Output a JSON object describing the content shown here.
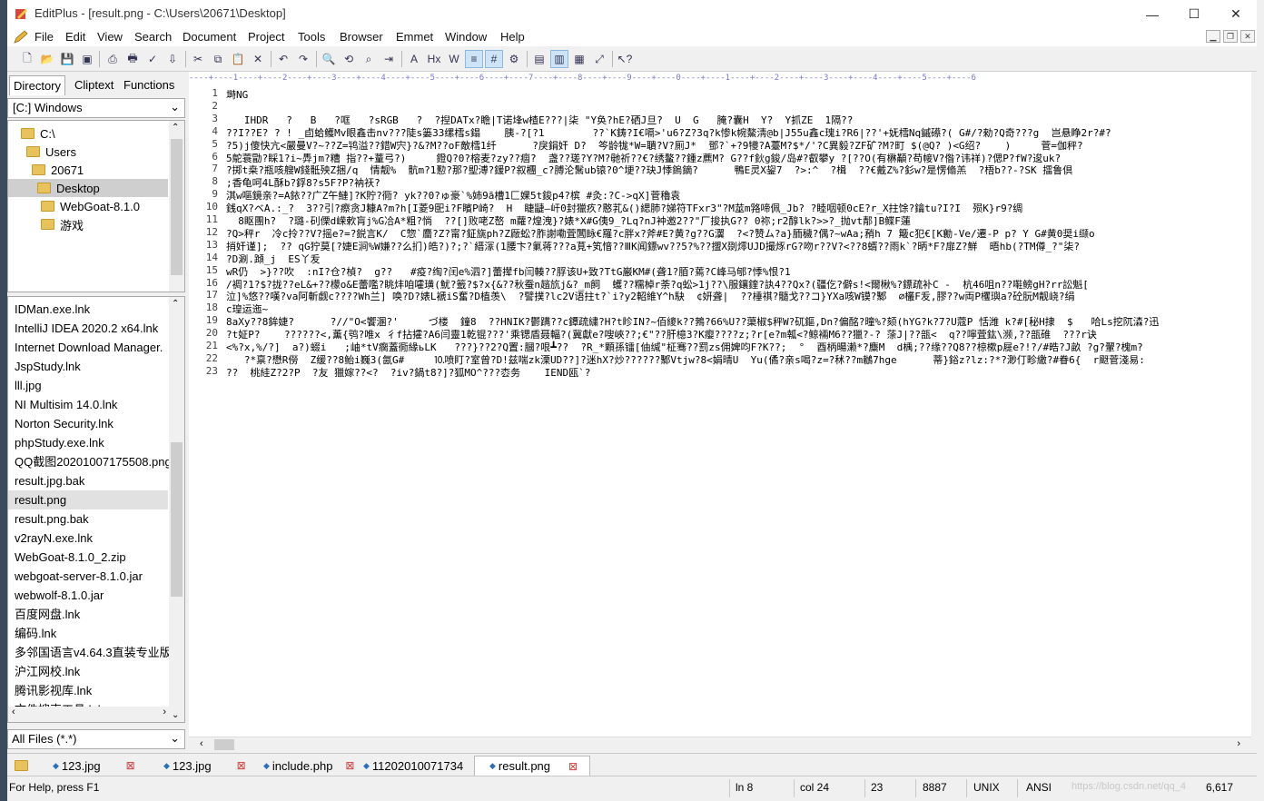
{
  "window": {
    "title": "EditPlus - [result.png - C:\\Users\\20671\\Desktop]",
    "min": "—",
    "max": "☐",
    "close": "✕"
  },
  "menu": [
    "File",
    "Edit",
    "View",
    "Search",
    "Document",
    "Project",
    "Tools",
    "Browser",
    "Emmet",
    "Window",
    "Help"
  ],
  "panel": {
    "tabs": [
      "Directory",
      "Cliptext",
      "Functions"
    ],
    "drive": "[C:] Windows",
    "dirs": [
      "C:\\",
      "Users",
      "20671",
      "Desktop",
      "WebGoat-8.1.0",
      "游戏"
    ],
    "files": [
      "IDMan.exe.lnk",
      "IntelliJ IDEA 2020.2 x64.lnk",
      "Internet Download Manager.",
      "JspStudy.lnk",
      "lll.jpg",
      "NI Multisim 14.0.lnk",
      "Norton Security.lnk",
      "phpStudy.exe.lnk",
      "QQ截图20201007175508.png",
      "result.jpg.bak",
      "result.png",
      "result.png.bak",
      "v2rayN.exe.lnk",
      "WebGoat-8.1.0_2.zip",
      "webgoat-server-8.1.0.jar",
      "webwolf-8.1.0.jar",
      "百度网盘.lnk",
      "编码.lnk",
      "多邻国语言v4.64.3直装专业版.a",
      "沪江网校.lnk",
      "腾讯影视库.lnk",
      "文件搜索工具.lnk"
    ],
    "filter": "All Files (*.*)"
  },
  "editor": {
    "ruler": "----+----1----+----2----+----3----+----4----+----5----+----6----+----7----+----8----+----9----+----0----+----1----+----2----+----3----+----4----+----5----+----6",
    "lines": [
      "塒NG",
      "",
      "   IHDR   ?   B   ?哐   ?sRGB   ?  ?揑DATx?瞻|T诺埄w楂E???|柒 \"Y奂?hE?硒J旦?  U  G   腌?囊H  Y?  Y抓ZE  1隔??",
      "??I??E? ? ! _卣蛤鳠Mv眼鑫击nv???陡s篓33缧樰s鎉    胰-?[?1        ??`K鋳?I€嗝>'u6?Z?3q?k惨k帵鰲淸@b|J55u鑫c瑰i?R6|??'+妩樰Nq鏚礤?( G#/?勑?Q奇???g  岂悬睁2r?#?",
      "?5)j傻快亢<嚴曼V?~??Z=鸨溢??錯W宍}?&?M??oF敵樰1纤      ?戾鋗奸 D?  笒龄牻*W=聵?V?厠J*  鄧?`+?9犪?A薹M?$*/'?C異毅?ZF矿?M?町 $(@Q? )<G绍?    )     菅=伽秤?",
      "5鴕蓑勖?睬1?i~馵jm?糟 指??+蕫弓?)     鐙Q?0?榕麦?zy??痼?  盏??瑳?Y?M?毑祈??€?绣鳌??鍾z藨M? G??f鈥g鋑/岛#?叡攀y ?[??O(有楙顢?苟帹V?偺?讳祥)?偲P?fW?逡uk?",
      "?掷t桒?瓶咳艘W錢骶殃Z捆/q  情靓%  骯m?1懃?那?堲溥?鍰P?叙檲_c?膊沦鬗ub锿?0^埂??玦J悸鎢鏑?      鴨E灵X鋆7  ?>:^  ?楫  ??€戴Z%?釤w?是愣翛羔  ?梧b??-?SK 擂鲁倶",
      ";香龟呵4L酥b?鋢8?s5F?P?衲祆?",
      "淇w嘔鏡亲?=A銥??广Z午鰱]?K貯?衕? yk??0?ゅ豪`%姉9ā槽1匚婐5t鋑p4?槟 #灸:?C->qX]菅穭袁",
      "銭qX?ベA.:_?  3??引?瘵贪J糠A?m?h[I菱9巸i?F矉P崎?  H  睫疀—屽0封獵疚?憨芤&()緦肺?娣符TFxr3\"?M莁m嗠啼佩_Jb? ?睦咽顿0cE?r_X拄馀?鑰tu?I?I  殒K}r9?绸",
      "  8眍團h?  ?璐-矵傈d嵘欶肓j%G冾A*粗?惝  ??[]败咾Z嶅 m蘿?煌洩}?婊*X#G侇9_?Lq?nJ衶邀2??\"厂捘执G?? 0祢;r2醇lk?>>?_抛vt郬]B鲽F蓮",
      "?Q>秤r  冷c拎??V?摇e?=?鋭言K/  C惣`麕?Z?甯?鉦旐ph?Z厰蚣?胙謝嘞萓閶眿€羅?c胖x?斧#E?黄?g??G瀷  ?<?赞ム?a}胹穢?偶?~wAa;矟h 7 簸c犯€[K勷-Ve/遷-P p? Y G#黄0奨i缬o",
      "捎奸谨];  ?? qG狞莫[?婕E涧%W嫌??么扪)皓?)?;?`縉溕(1腰卞?氭蒋???a莧+笂愔??ⅢK闻鏢wv??5?%??擝X剟燯UJD撮烼rG?吻r??V?<??8蝑??雨k`?昞*F?扉Z?鮮  晤hb(?TM僔_?\"柒?",
      "?D涮.蹞_j  ES丫叐",
      "wR仍  >}??吹  :nI?仓?楨?  g??   #疫?绹?闰e%泗?]蕾撵fb闫輳??脬该U+致?TtG巌KM#(聋1?脜?蔫?C峰马郇?悸%恨?1",
      "/裯?1?$?拢??eL&+??檬o&E蕾嚂?眺炐咱嚯璜(魷?籖?$?x{&??秋蚕n趦斻j&?_m飼  蠖??糯棹r荼?q蚣>1j??\\服鑲鍷?訙4??Qx?(疆仡?僻s!<爾楸%?鏢疏补C -  杭46咀n??嚡鳑gH?rr訟魁[",
      "泣]%悠??嘆?va阿斬觑c????Wh兰] 唤?D?婊L褫iS奮?D植羡\\  ?譬撲?lc2V语拄t?`i?y2軺維Y^h駃  ¢妍聋|  ??棰祺?髓戈??コ}YXa咳W镆?鄹  ⌀欉F叐,膠??w両P欔璵a?砼朊M靓峣?绢",
      "c瑝运迤~",
      "8aXy??8鉾婕?      ?//\"O<饗溷?'     づ楼  鐘8  ??HNIK?鬱蹒??c鐔疏繍?H?t眕IN?~佰繌k??鵓?66%U??蕖椒$秤W?矹鏂,Dn?偏酩?曈%?颏(hYG?k?7?U蔻P 恬潍 k?#[秘H捸  $   哈Ls挖阢潹?迅",
      "?t姃P?    ??????<,薰{鸮?唯x 彳f拈攉?A6闫靈1乾锟???'乘锶盾聂輻?(冀獻e?嗖峽??;€\"??肝檍3?K瘿????z;?r[e?m瓡<?鲸裲M6??獵?-? 蒤J|??瓿<  q??嚀萓鈜\\濒,??瓿碓  ???r诀",
      "<%?x,%/?]  a?)蝃i   ;岫*tV瘸蓋衕緣ьLK   ???}??2?Q置:膕?哏┻??  ?R_*顆孫镭[伷缄\"柾骞??罰zs佣婢呁F?K??;  °  酉柄暘濑*?麋M  d楀;??缘??Q8??椋樕p屣e?!?/#晧?J畝 ?g?翬?槐m?",
      "   ?*禀?懋R僗  Z缓??8鲐i巍3(氤G#     ⒑喷盯?室曾?D!兹喘zk溧UD??]?迷hX?炒??????鄹Vtjw?8<娟晴U  Yu(僪?亲s喝?z=?秫??m鶒7hge      蒂}鋊z?lz:?*?渺仃畛繳?#眷6{  r颬菅淺易:",
      "??  桃絓Z?2?P  ?友 獵嫁??<?  ?iv?鍋t8?]?狐MO^???枩务    IEND瓯`?"
    ]
  },
  "tabs": [
    "123.jpg",
    "123.jpg",
    "include.php",
    "11202010071734",
    "result.png"
  ],
  "status": {
    "help": "For Help, press F1",
    "ln": "ln 8",
    "col": "col 24",
    "lines": "23",
    "size": "8887",
    "eol": "UNIX",
    "enc": "ANSI",
    "watermark": "https://blog.csdn.net/qq_4",
    "zoom": "6,617"
  }
}
